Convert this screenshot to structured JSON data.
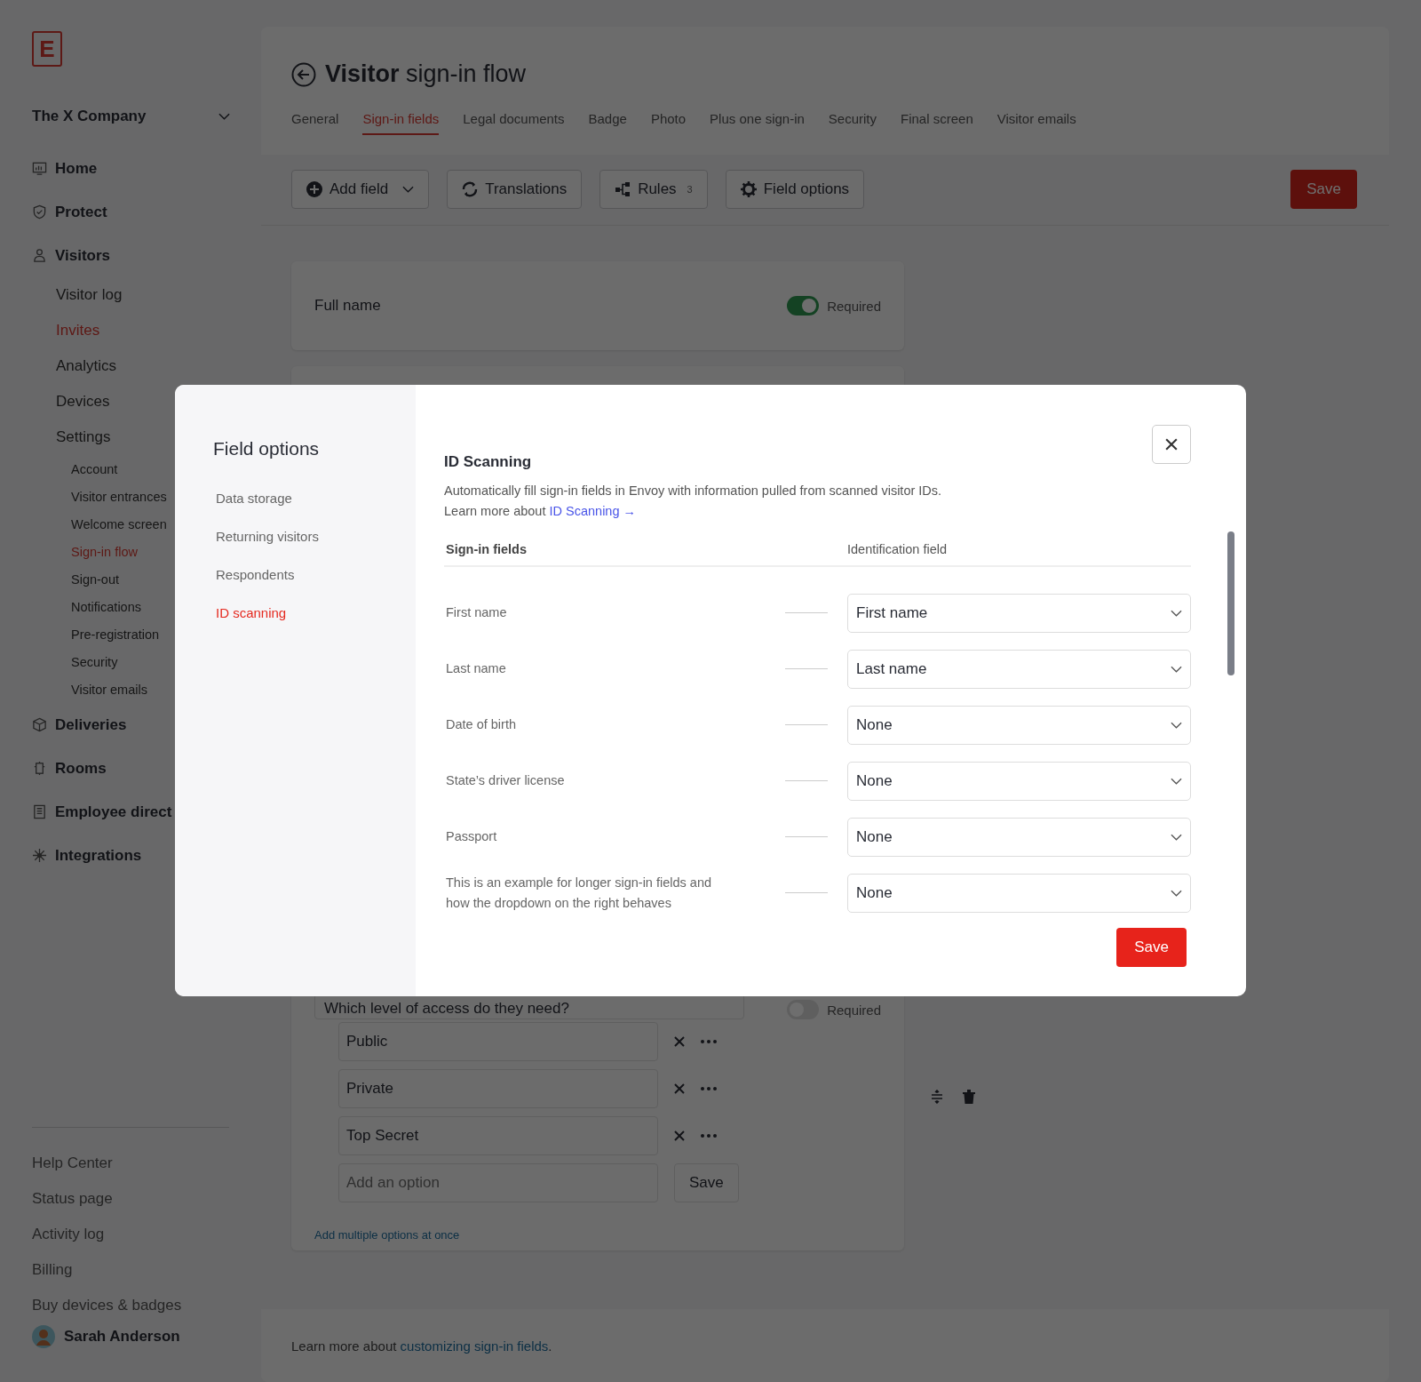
{
  "sidebar": {
    "logo": "E",
    "company": "The X Company",
    "nav": [
      {
        "label": "Home",
        "selected": false
      },
      {
        "label": "Protect",
        "selected": false
      },
      {
        "label": "Visitors",
        "selected": false,
        "children": [
          {
            "label": "Visitor log",
            "selected": false
          },
          {
            "label": "Invites",
            "selected": true
          },
          {
            "label": "Analytics",
            "selected": false
          },
          {
            "label": "Devices",
            "selected": false
          },
          {
            "label": "Settings",
            "selected": false,
            "children": [
              {
                "label": "Account",
                "selected": false
              },
              {
                "label": "Visitor entrances",
                "selected": false
              },
              {
                "label": "Welcome screen",
                "selected": false
              },
              {
                "label": "Sign-in flow",
                "selected": true
              },
              {
                "label": "Sign-out",
                "selected": false
              },
              {
                "label": "Notifications",
                "selected": false
              },
              {
                "label": "Pre-registration",
                "selected": false
              },
              {
                "label": "Security",
                "selected": false
              },
              {
                "label": "Visitor emails",
                "selected": false
              }
            ]
          }
        ]
      },
      {
        "label": "Deliveries",
        "selected": false
      },
      {
        "label": "Rooms",
        "selected": false
      },
      {
        "label": "Employee direct",
        "selected": false
      },
      {
        "label": "Integrations",
        "selected": false
      }
    ],
    "footer_links": [
      "Help Center",
      "Status page",
      "Activity log",
      "Billing",
      "Buy devices & badges"
    ],
    "user": "Sarah Anderson"
  },
  "header": {
    "title": "**Visitor** sign-in flow",
    "tabs": [
      {
        "label": "General",
        "selected": false
      },
      {
        "label": "Sign-in fields",
        "selected": true
      },
      {
        "label": "Legal documents",
        "selected": false
      },
      {
        "label": "Badge",
        "selected": false
      },
      {
        "label": "Photo",
        "selected": false
      },
      {
        "label": "Plus one sign-in",
        "selected": false
      },
      {
        "label": "Security",
        "selected": false
      },
      {
        "label": "Final screen",
        "selected": false
      },
      {
        "label": "Visitor emails",
        "selected": false
      }
    ]
  },
  "toolbar": {
    "buttons": [
      {
        "kind": "add",
        "label": "Add field"
      },
      {
        "kind": "translate",
        "label": "Translations"
      },
      {
        "kind": "rules",
        "label": "Rules",
        "count": "3"
      },
      {
        "kind": "options",
        "label": "Field options"
      }
    ],
    "save": "Save"
  },
  "fields": [
    {
      "kind": "text",
      "label": "Full name",
      "required": true,
      "required_label": "Required"
    },
    {
      "kind": "choice",
      "label": "Which level of access do they need?",
      "required": false,
      "required_label": "Required",
      "options": [
        "Public",
        "Private",
        "Top Secret"
      ],
      "placeholder": "Add an option",
      "save": "Save",
      "link": "Add multiple options at once"
    }
  ],
  "footer": {
    "text": "Learn more about ",
    "link": "customizing sign-in fields",
    "end": "."
  },
  "modal": {
    "title": "Field options",
    "nav": [
      {
        "label": "Data storage",
        "selected": false
      },
      {
        "label": "Returning visitors",
        "selected": false
      },
      {
        "label": "Respondents",
        "selected": false
      },
      {
        "label": "ID scanning",
        "selected": true
      }
    ],
    "heading": "ID Scanning",
    "description": "Automatically fill sign-in fields in Envoy with information pulled from scanned visitor IDs.",
    "learn": "Learn more about ",
    "learn_link": "ID Scanning →",
    "columns": [
      "Sign-in fields",
      "Identification field"
    ],
    "rows": [
      {
        "field": "First name",
        "value": "First name"
      },
      {
        "field": "Last name",
        "value": "Last name"
      },
      {
        "field": "Date of birth",
        "value": "None"
      },
      {
        "field": "State’s driver license",
        "value": "None"
      },
      {
        "field": "Passport",
        "value": "None"
      },
      {
        "field": "This is an example for longer sign-in fields and how the dropdown on the right behaves",
        "value": "None"
      }
    ],
    "save": "Save"
  }
}
